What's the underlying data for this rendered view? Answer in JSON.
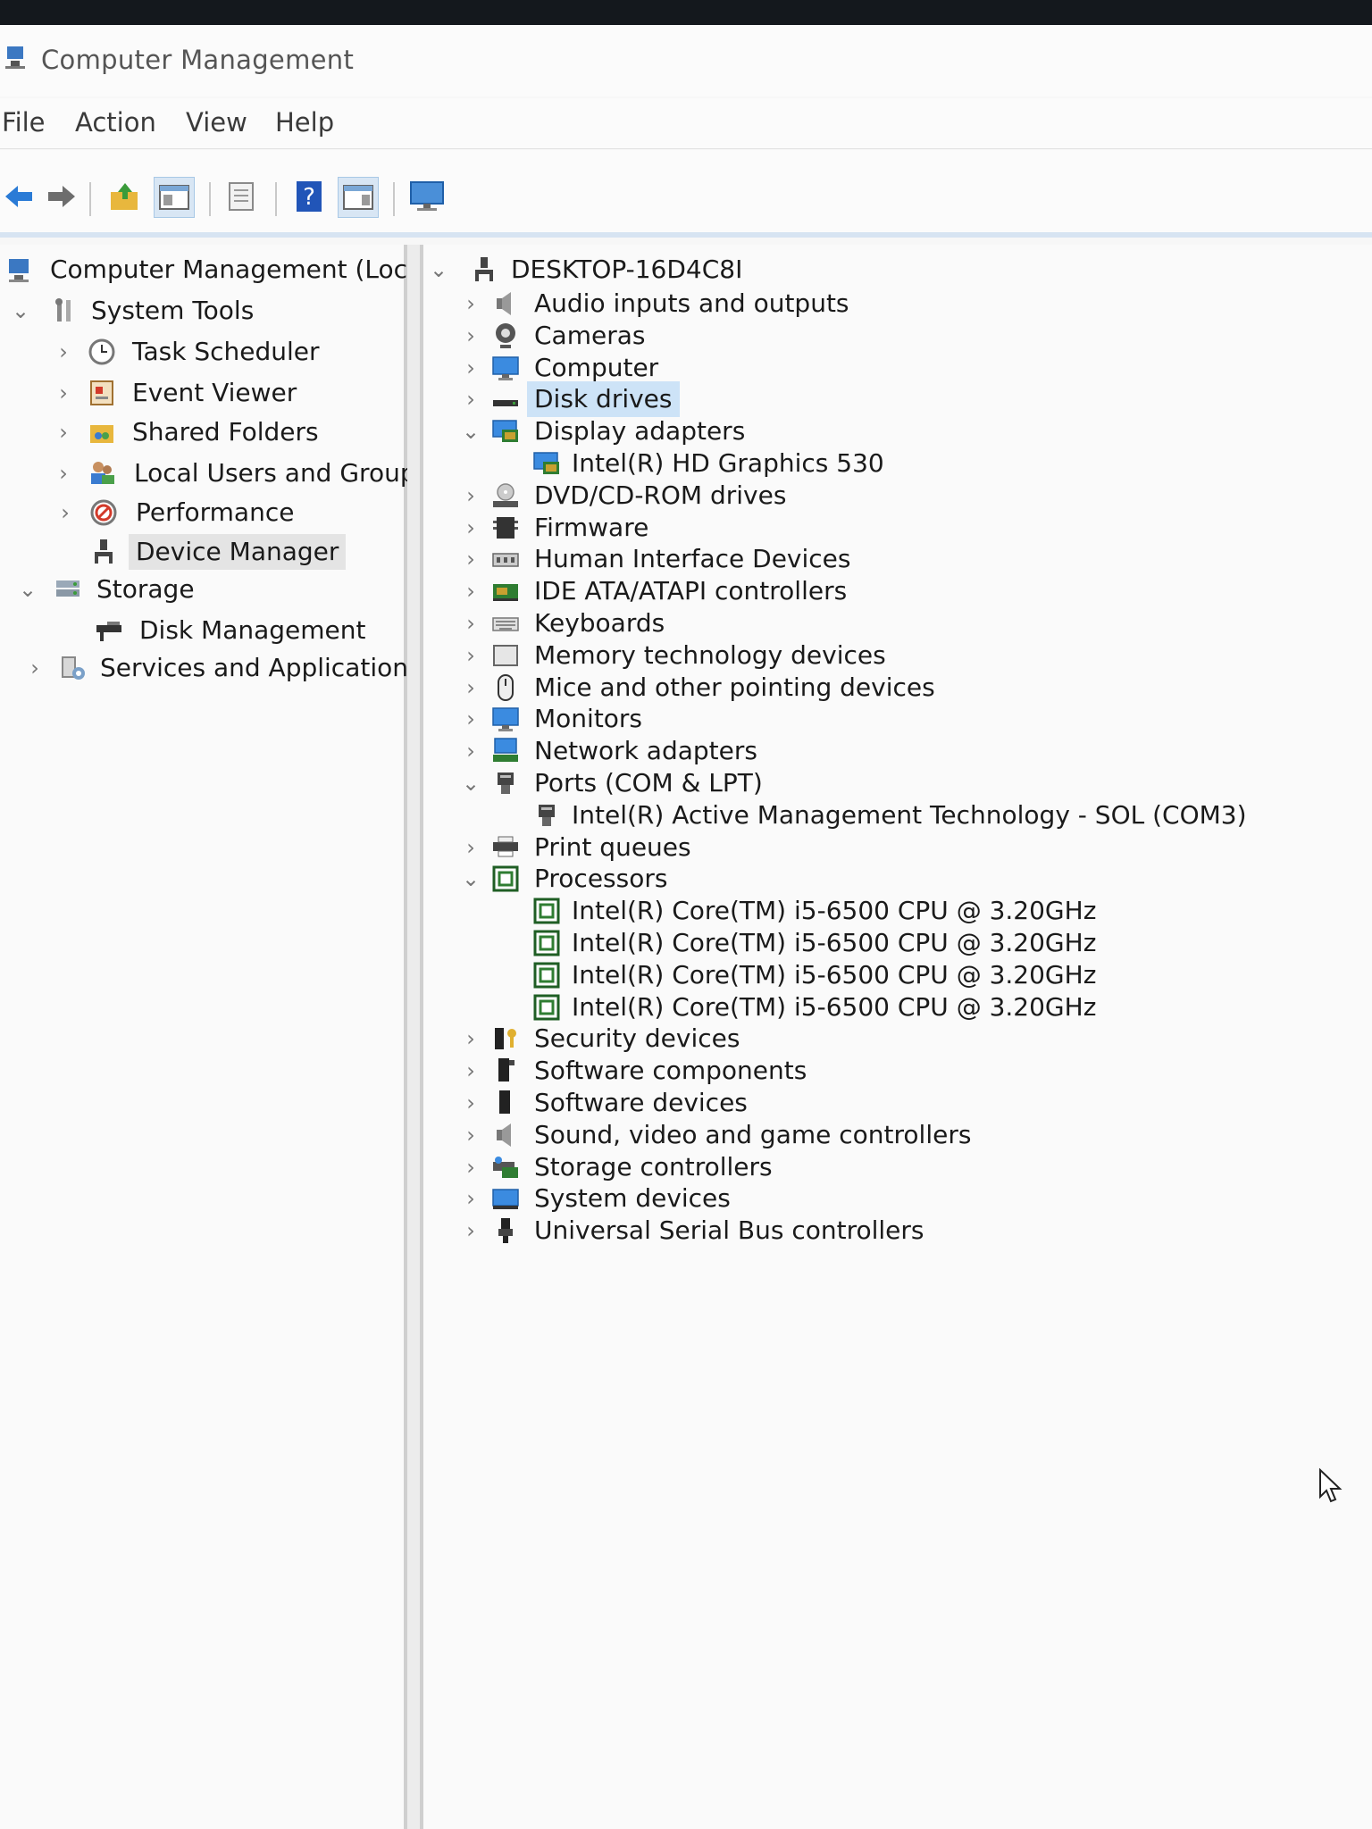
{
  "window": {
    "title": "Computer Management"
  },
  "menu": {
    "file": "File",
    "action": "Action",
    "view": "View",
    "help": "Help"
  },
  "toolbar": {
    "buttons": [
      "back-icon",
      "forward-icon",
      "up-folder-icon",
      "show-hide-tree-icon",
      "properties-icon",
      "help-icon",
      "action-pane-icon",
      "monitor-icon"
    ]
  },
  "left_tree": {
    "root": "Computer Management (Local",
    "system_tools": "System Tools",
    "task_scheduler": "Task Scheduler",
    "event_viewer": "Event Viewer",
    "shared_folders": "Shared Folders",
    "local_users": "Local Users and Groups",
    "performance": "Performance",
    "device_manager": "Device Manager",
    "storage": "Storage",
    "disk_management": "Disk Management",
    "services": "Services and Applications"
  },
  "device_tree": {
    "computer_name": "DESKTOP-16D4C8I",
    "categories": [
      {
        "label": "Audio inputs and outputs",
        "expanded": false
      },
      {
        "label": "Cameras",
        "expanded": false
      },
      {
        "label": "Computer",
        "expanded": false
      },
      {
        "label": "Disk drives",
        "expanded": false,
        "selected": true
      },
      {
        "label": "Display adapters",
        "expanded": true,
        "children": [
          "Intel(R) HD Graphics 530"
        ]
      },
      {
        "label": "DVD/CD-ROM drives",
        "expanded": false
      },
      {
        "label": "Firmware",
        "expanded": false
      },
      {
        "label": "Human Interface Devices",
        "expanded": false
      },
      {
        "label": "IDE ATA/ATAPI controllers",
        "expanded": false
      },
      {
        "label": "Keyboards",
        "expanded": false
      },
      {
        "label": "Memory technology devices",
        "expanded": false
      },
      {
        "label": "Mice and other pointing devices",
        "expanded": false
      },
      {
        "label": "Monitors",
        "expanded": false
      },
      {
        "label": "Network adapters",
        "expanded": false
      },
      {
        "label": "Ports (COM & LPT)",
        "expanded": true,
        "children": [
          "Intel(R) Active Management Technology - SOL (COM3)"
        ]
      },
      {
        "label": "Print queues",
        "expanded": false
      },
      {
        "label": "Processors",
        "expanded": true,
        "children": [
          "Intel(R) Core(TM) i5-6500 CPU @ 3.20GHz",
          "Intel(R) Core(TM) i5-6500 CPU @ 3.20GHz",
          "Intel(R) Core(TM) i5-6500 CPU @ 3.20GHz",
          "Intel(R) Core(TM) i5-6500 CPU @ 3.20GHz"
        ]
      },
      {
        "label": "Security devices",
        "expanded": false
      },
      {
        "label": "Software components",
        "expanded": false
      },
      {
        "label": "Software devices",
        "expanded": false
      },
      {
        "label": "Sound, video and game controllers",
        "expanded": false
      },
      {
        "label": "Storage controllers",
        "expanded": false
      },
      {
        "label": "System devices",
        "expanded": false
      },
      {
        "label": "Universal Serial Bus controllers",
        "expanded": false
      }
    ]
  },
  "colors": {
    "selection": "#cde3f7",
    "accent": "#1a6fc4",
    "chip_green": "#2f7d32"
  }
}
